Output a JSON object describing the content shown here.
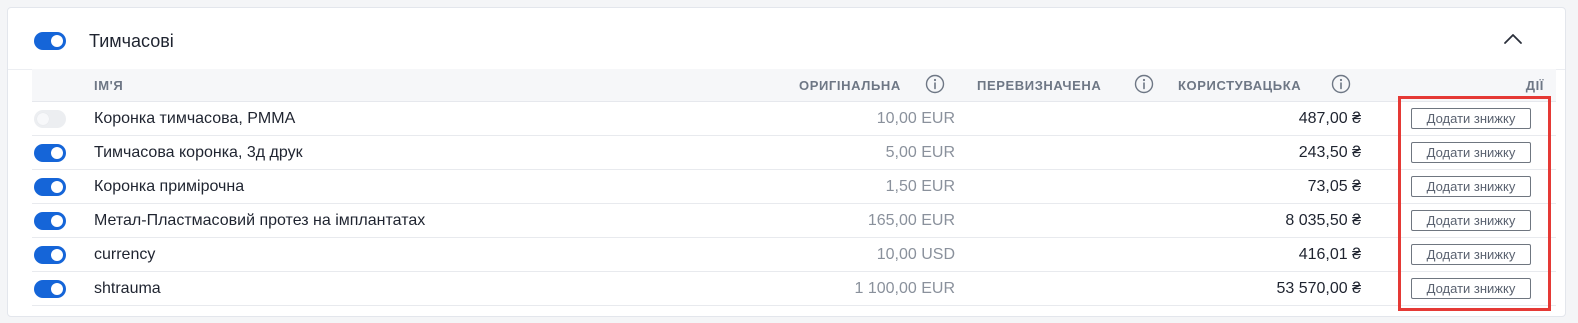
{
  "section": {
    "title": "Тимчасові",
    "enabled": true
  },
  "table": {
    "headers": {
      "name": "ІМ'Я",
      "original": "ОРИГІНАЛЬНА",
      "overridden": "ПЕРЕВИЗНАЧЕНА",
      "user": "КОРИСТУВАЦЬКА",
      "actions": "ДІЇ"
    },
    "rows": [
      {
        "enabled": false,
        "name": "Коронка тимчасова, PMMA",
        "original": "10,00 EUR",
        "overridden": "",
        "user": "487,00 ₴",
        "action": "Додати знижку"
      },
      {
        "enabled": true,
        "name": "Тимчасова коронка, 3д друк",
        "original": "5,00 EUR",
        "overridden": "",
        "user": "243,50 ₴",
        "action": "Додати знижку"
      },
      {
        "enabled": true,
        "name": "Коронка примірочна",
        "original": "1,50 EUR",
        "overridden": "",
        "user": "73,05 ₴",
        "action": "Додати знижку"
      },
      {
        "enabled": true,
        "name": "Метал-Пластмасовий протез на імплантатах",
        "original": "165,00 EUR",
        "overridden": "",
        "user": "8 035,50 ₴",
        "action": "Додати знижку"
      },
      {
        "enabled": true,
        "name": "currency",
        "original": "10,00 USD",
        "overridden": "",
        "user": "416,01 ₴",
        "action": "Додати знижку"
      },
      {
        "enabled": true,
        "name": "shtrauma",
        "original": "1 100,00 EUR",
        "overridden": "",
        "user": "53 570,00 ₴",
        "action": "Додати знижку"
      }
    ]
  },
  "colors": {
    "accent": "#1565d8",
    "highlight": "#e53935"
  },
  "icons": {
    "collapse": "chevron-up-icon",
    "info": "info-icon"
  }
}
